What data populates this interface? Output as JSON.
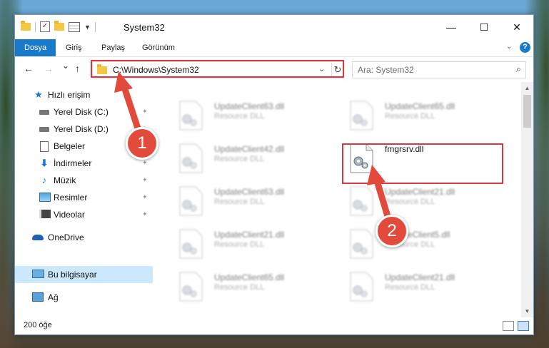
{
  "window": {
    "title": "System32",
    "minimize_glyph": "—",
    "maximize_glyph": "☐",
    "close_glyph": "✕"
  },
  "ribbon": {
    "tabs": [
      "Dosya",
      "Giriş",
      "Paylaş",
      "Görünüm"
    ],
    "help_glyph": "?"
  },
  "navigation": {
    "back_glyph": "←",
    "forward_glyph": "→",
    "recent_glyph": "⌄",
    "up_glyph": "↑",
    "address": "C:\\Windows\\System32",
    "search_placeholder": "Ara: System32"
  },
  "sidebar": {
    "items": [
      {
        "label": "Hızlı erişim",
        "icon": "star-icon",
        "pinned": false
      },
      {
        "label": "Yerel Disk (C:)",
        "icon": "drive-icon",
        "pinned": true
      },
      {
        "label": "Yerel Disk (D:)",
        "icon": "drive-icon",
        "pinned": true
      },
      {
        "label": "Belgeler",
        "icon": "document-icon",
        "pinned": true
      },
      {
        "label": "İndirmeler",
        "icon": "download-icon",
        "pinned": true
      },
      {
        "label": "Müzik",
        "icon": "music-icon",
        "pinned": true
      },
      {
        "label": "Resimler",
        "icon": "picture-icon",
        "pinned": true
      },
      {
        "label": "Videolar",
        "icon": "video-icon",
        "pinned": true
      },
      {
        "label": "OneDrive",
        "icon": "cloud-icon",
        "pinned": false
      },
      {
        "label": "Bu bilgisayar",
        "icon": "computer-icon",
        "pinned": false,
        "selected": true
      },
      {
        "label": "Ağ",
        "icon": "network-icon",
        "pinned": false
      }
    ]
  },
  "files": [
    {
      "name": "UpdateClient63.dll",
      "type": "Resource DLL",
      "blurred": true
    },
    {
      "name": "UpdateClient65.dll",
      "type": "Resource DLL",
      "blurred": true
    },
    {
      "name": "UpdateClient42.dll",
      "type": "Resource DLL",
      "blurred": true
    },
    {
      "name": "fmgrsrv.dll",
      "type": "",
      "blurred": false,
      "highlighted": true
    },
    {
      "name": "UpdateClient63.dll",
      "type": "Resource DLL",
      "blurred": true
    },
    {
      "name": "UpdateClient21.dll",
      "type": "Resource DLL",
      "blurred": true
    },
    {
      "name": "UpdateClient21.dll",
      "type": "Resource DLL",
      "blurred": true
    },
    {
      "name": "UpdateClient5.dll",
      "type": "Resource DLL",
      "blurred": true
    },
    {
      "name": "UpdateClient65.dll",
      "type": "Resource DLL",
      "blurred": true
    },
    {
      "name": "UpdateClient21.dll",
      "type": "Resource DLL",
      "blurred": true
    }
  ],
  "status": {
    "item_count": "200 öğe"
  },
  "annotations": {
    "step1_label": "1",
    "step2_label": "2",
    "highlight_color": "#d9373f",
    "badge_color": "#e24b3b"
  },
  "colors": {
    "accent": "#1979ca",
    "selection": "#cce8ff"
  }
}
